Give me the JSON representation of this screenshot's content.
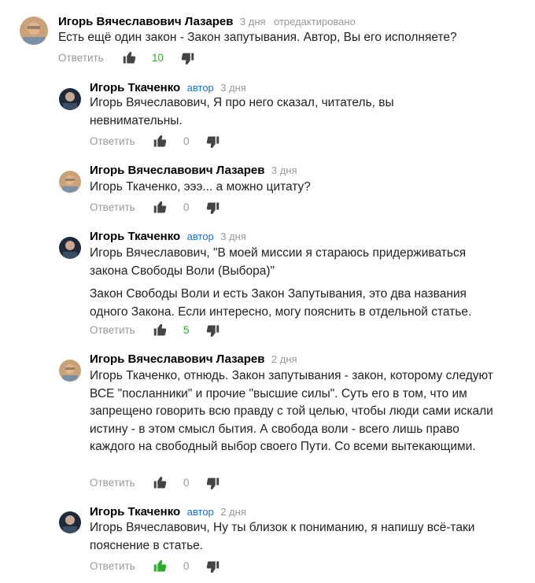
{
  "labels": {
    "reply": "Ответить",
    "author_badge": "автор",
    "edited": "отредактировано"
  },
  "colors": {
    "liked_thumb": "#2cab2c",
    "thumb": "#444444",
    "positive_count": "#2cab2c",
    "author_badge": "#1a6fd6"
  },
  "comments": [
    {
      "author": "Игорь Вячеславович Лазарев",
      "date": "3 дня",
      "edited": true,
      "paragraphs": [
        "Есть ещё один закон - Закон запутывания. Автор, Вы его исполняете?"
      ],
      "likes": "10",
      "liked": false
    },
    {
      "author": "Игорь Ткаченко",
      "is_author": true,
      "date": "3 дня",
      "paragraphs": [
        "Игорь Вячеславович, Я про него сказал, читатель, вы невнимательны."
      ],
      "likes": "0",
      "liked": false
    },
    {
      "author": "Игорь Вячеславович Лазарев",
      "date": "3 дня",
      "paragraphs": [
        "Игорь Ткаченко, эээ... а можно цитату?"
      ],
      "likes": "0",
      "liked": false
    },
    {
      "author": "Игорь Ткаченко",
      "is_author": true,
      "date": "3 дня",
      "paragraphs": [
        "Игорь Вячеславович, \"В моей миссии я стараюсь придерживаться закона Свободы Воли (Выбора)\"",
        "Закон Свободы Воли и есть Закон Запутывания, это два названия одного Закона. Если интересно, могу пояснить в отдельной статье."
      ],
      "likes": "5",
      "liked": false
    },
    {
      "author": "Игорь Вячеславович Лазарев",
      "date": "2 дня",
      "paragraphs": [
        "Игорь Ткаченко, отнюдь. Закон запутывания - закон, которому следуют ВСЕ \"посланники\" и прочие \"высшие силы\". Суть его в том, что им запрещено говорить всю правду с той целью, чтобы люди сами искали истину - в этом смысл бытия. А свобода воли - всего лишь право каждого на свободный выбор своего Пути. Со всеми вытекающими."
      ],
      "likes": "0",
      "liked": false
    },
    {
      "author": "Игорь Ткаченко",
      "is_author": true,
      "date": "2 дня",
      "paragraphs": [
        "Игорь Вячеславович, Ну ты близок к пониманию, я напишу всё-таки пояснение в статье."
      ],
      "likes": "0",
      "liked": true
    }
  ]
}
